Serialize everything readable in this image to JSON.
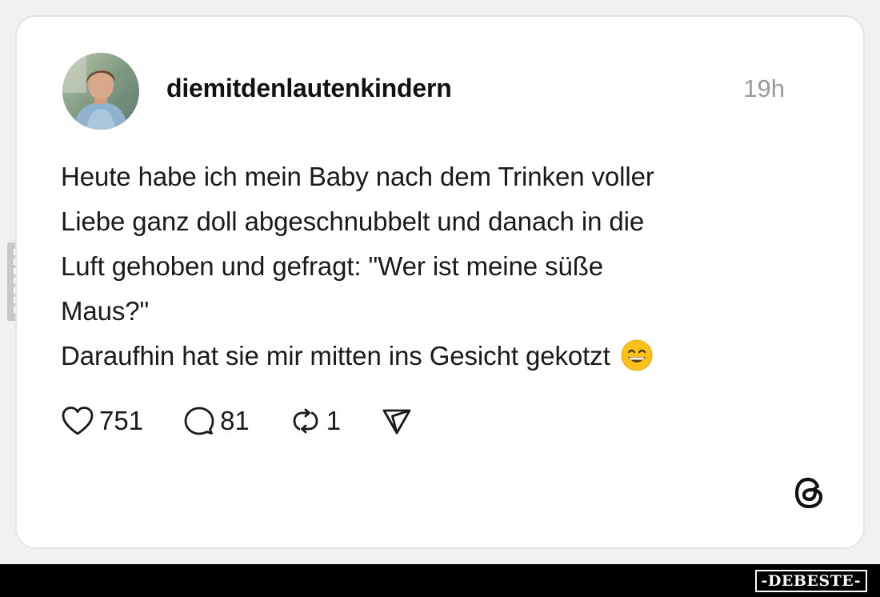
{
  "post": {
    "username": "diemitdenlautenkindern",
    "time": "19h",
    "text_lines": [
      "Heute habe ich mein Baby nach dem Trinken voller",
      "Liebe ganz doll abgeschnubbelt und danach in die",
      "Luft gehoben und gefragt: \"Wer ist meine süße",
      "Maus?\"",
      "Daraufhin hat sie mir mitten ins Gesicht gekotzt"
    ],
    "emoji": "grinning-face-with-smiling-eyes"
  },
  "actions": {
    "likes": "751",
    "replies": "81",
    "reposts": "1"
  },
  "icons": {
    "like": "heart-icon",
    "reply": "comment-bubble-icon",
    "repost": "repost-icon",
    "share": "send-icon",
    "platform": "threads-logo"
  },
  "watermark": {
    "side": "DEBESTE",
    "footer": "-DEBESTE-"
  },
  "colors": {
    "card_background": "#ffffff",
    "page_background": "#f1f1f1",
    "text": "#1a1a1a",
    "timestamp": "#9a9a9a",
    "footer_bar": "#000000"
  }
}
